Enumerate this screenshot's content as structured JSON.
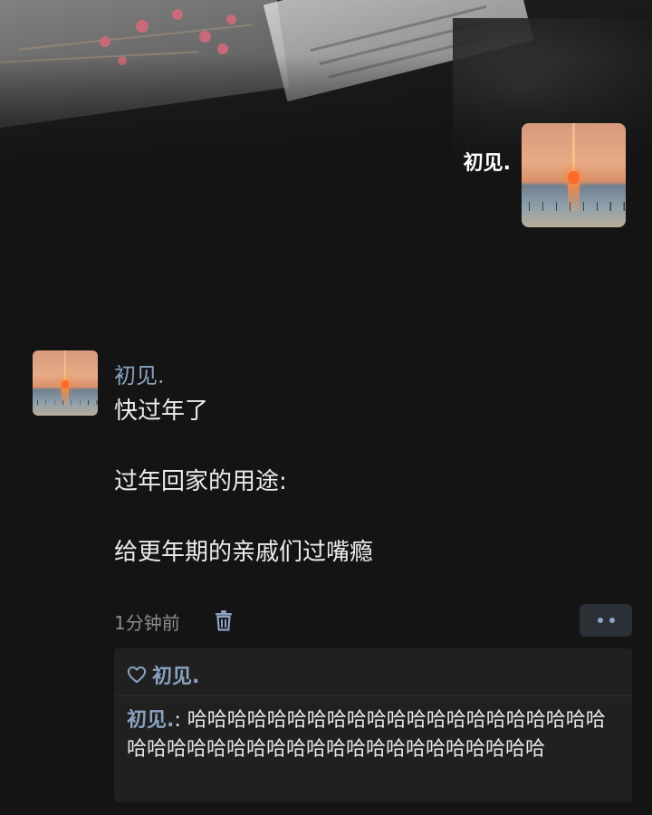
{
  "profile": {
    "name": "初见.",
    "avatar_icon": "sunset-beach-avatar"
  },
  "post": {
    "author": "初见.",
    "avatar_icon": "sunset-beach-avatar",
    "lines": [
      "快过年了",
      "过年回家的用途:",
      "给更年期的亲戚们过嘴瘾"
    ],
    "time": "1分钟前",
    "delete_icon": "trash-icon",
    "more_icon": "more-dots-icon"
  },
  "likes": {
    "icon": "heart-outline-icon",
    "names": "初见."
  },
  "comments": [
    {
      "author": "初见.",
      "separator": ": ",
      "text": "哈哈哈哈哈哈哈哈哈哈哈哈哈哈哈哈哈哈哈哈哈哈哈哈哈哈哈哈哈哈哈哈哈哈哈哈哈哈哈哈哈哈"
    }
  ],
  "colors": {
    "background": "#141414",
    "link_blue": "#8aa2c0",
    "text_primary": "#ececec",
    "text_secondary": "#8d8d8d",
    "panel": "#202020",
    "button_bg": "#2b2f36"
  }
}
